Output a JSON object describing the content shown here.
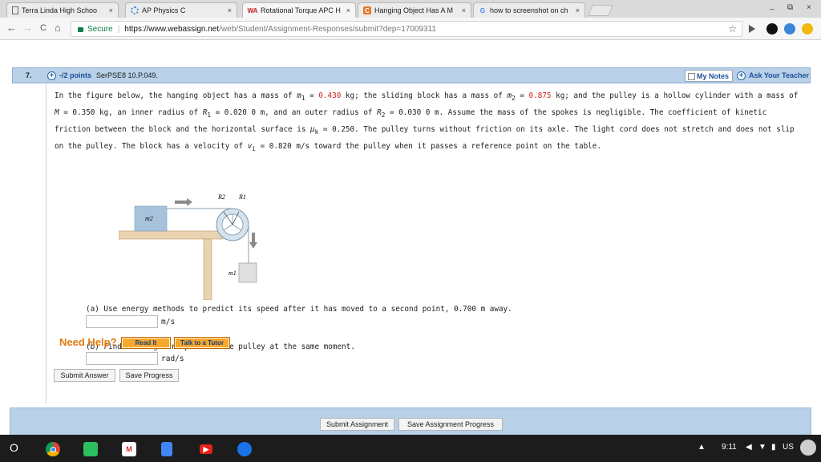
{
  "browser": {
    "tabs": [
      {
        "title": "Terra Linda High Schoo",
        "favicon": "page-icon",
        "active": false
      },
      {
        "title": "AP Physics C",
        "favicon": "loading-icon",
        "active": false
      },
      {
        "title": "Rotational Torque APC H",
        "favicon": "webassign-icon",
        "active": true
      },
      {
        "title": "Hanging Object Has A M",
        "favicon": "chegg-icon",
        "active": false
      },
      {
        "title": "how to screenshot on ch",
        "favicon": "google-icon",
        "active": false
      }
    ],
    "tab_close": "×",
    "win_minimize": "_",
    "win_restore": "⧉",
    "win_close": "×",
    "back": "←",
    "forward": "→",
    "reload": "C",
    "home": "⌂",
    "secure_label": "Secure",
    "url_host": "https://www.webassign.net",
    "url_path": "/web/Student/Assignment-Responses/submit?dep=17009311",
    "star": "☆"
  },
  "question": {
    "number": "7.",
    "points": "-/2 points",
    "code": "SerPSE8 10.P.049.",
    "my_notes": "My Notes",
    "ask_teacher": "Ask Your Teacher",
    "para": {
      "t1": "In the figure below, the hanging object has a mass of ",
      "m1_sym": "m",
      "m1_sub": "1",
      "eq1": " = ",
      "m1_val": "0.430",
      "t2": " kg; the sliding block has a mass of ",
      "m2_sym": "m",
      "m2_sub": "2",
      "eq2": " = ",
      "m2_val": "0.875",
      "t3": " kg; and the pulley is a hollow cylinder with a mass of ",
      "M_sym": "M",
      "t4": " = 0.350 kg, an inner radius of ",
      "R1_sym": "R",
      "R1_sub": "1",
      "t5": " = 0.020 0 m, and an outer radius of ",
      "R2_sym": "R",
      "R2_sub": "2",
      "t6": " = 0.030 0 m. Assume the mass of the spokes is negligible. The coefficient of kinetic friction between the block and the horizontal surface is ",
      "mu_sym": "μ",
      "mu_sub": "k",
      "t7": " = 0.250. The pulley turns without friction on its axle. The light cord does not stretch and does not slip on the pulley. The block has a velocity of ",
      "v_sym": "v",
      "v_sub": "i",
      "t8": " = 0.820 m/s toward the pulley when it passes a reference point on the table."
    },
    "figure": {
      "label_m2": "m2",
      "label_m1": "m1",
      "label_R2": "R2",
      "label_R1": "R1"
    },
    "part_a": {
      "prompt": "(a) Use energy methods to predict its speed after it has moved to a second point, 0.700 m away.",
      "value": "",
      "unit": "m/s"
    },
    "part_b": {
      "prompt": "(b) Find the angular speed of the pulley at the same moment.",
      "value": "",
      "unit": "rad/s"
    },
    "need_help": "Need Help?",
    "read_it": "Read It",
    "talk_tutor": "Talk to a Tutor",
    "submit_answer": "Submit Answer",
    "save_progress": "Save Progress"
  },
  "footer": {
    "submit_assignment": "Submit Assignment",
    "save_assignment": "Save Assignment Progress"
  },
  "shelf": {
    "launcher": "O",
    "apps": [
      "chrome-icon",
      "evernote-icon",
      "gmail-icon",
      "docs-icon",
      "youtube-icon",
      "files-icon"
    ],
    "time": "9:11",
    "locale": "US"
  },
  "colors": {
    "accent": "#1a4f97",
    "header_bg": "#b8d0e8",
    "highlight_red": "#d4201a",
    "help_orange": "#f7a82e"
  }
}
